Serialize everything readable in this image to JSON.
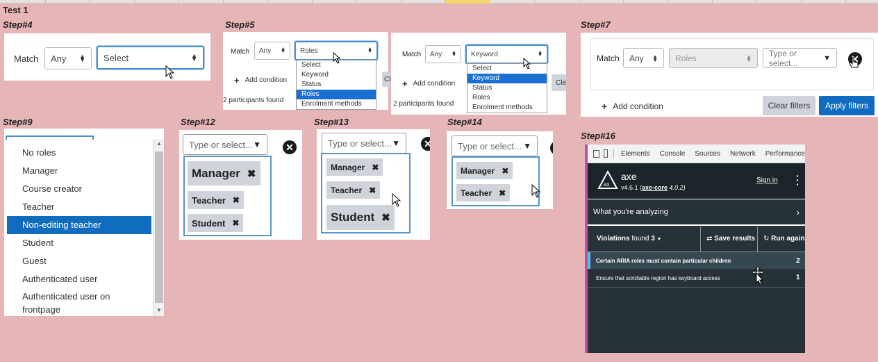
{
  "sheet_title": "Test 1",
  "common": {
    "match_label": "Match",
    "any_value": "Any",
    "add_condition": "Add condition",
    "participants_found": "2 participants found",
    "clear_filters": "Clear filters",
    "apply_filters": "Apply filters",
    "type_or_select": "Type or select...",
    "clear_partial": "Cl",
    "clear_partial_2": "Cle"
  },
  "step4": {
    "label": "Step#4",
    "select_value": "Select"
  },
  "step5": {
    "label": "Step#5",
    "panel_a": {
      "select_value": "Roles",
      "options": [
        "Select",
        "Keyword",
        "Status",
        "Roles",
        "Enrolment methods"
      ],
      "active_index": 3
    },
    "panel_b": {
      "select_value": "Keyword",
      "options": [
        "Select",
        "Keyword",
        "Status",
        "Roles",
        "Enrolment methods"
      ],
      "active_index": 1
    }
  },
  "step7": {
    "label": "Step#7",
    "roles_value": "Roles"
  },
  "step9": {
    "label": "Step#9",
    "items": [
      "No roles",
      "Manager",
      "Course creator",
      "Teacher",
      "Non-editing teacher",
      "Student",
      "Guest",
      "Authenticated user",
      "Authenticated user on frontpage"
    ],
    "active_index": 4
  },
  "step12": {
    "label": "Step#12",
    "tags": [
      "Manager",
      "Teacher",
      "Student"
    ]
  },
  "step13": {
    "label": "Step#13",
    "tags": [
      "Manager",
      "Teacher",
      "Student"
    ]
  },
  "step14": {
    "label": "Step#14",
    "tags": [
      "Manager",
      "Teacher"
    ]
  },
  "step16": {
    "label": "Step#16",
    "devtools_tabs": [
      "Elements",
      "Console",
      "Sources",
      "Network",
      "Performance"
    ],
    "axe_name": "axe",
    "axe_version": "v4.6.1 (",
    "axe_core_link": "axe-core",
    "axe_core_version": " 4.0.2)",
    "sign_in": "Sign in",
    "analyzing": "What you're analyzing",
    "violations_label": "Violations",
    "found_label": "found",
    "violations_count": "3",
    "save_results": "Save results",
    "run_again": "Run again",
    "issues": [
      {
        "text": "Certain ARIA roles must contain particular children",
        "count": "2"
      },
      {
        "text": "Ensure that scrollable region has keyboard access",
        "count": "1"
      }
    ]
  },
  "colors": {
    "background": "#e5b5b8",
    "focus_border": "#4a8fd0",
    "active_item": "#0f6cbf",
    "devtools_bg": "#263238",
    "axe_highlight": "#1e88e5"
  },
  "icons": [
    "up-down-arrows-icon",
    "caret-down-icon",
    "close-circle-icon",
    "remove-x-icon",
    "plus-icon",
    "mouse-pointer-icon",
    "hand-pointer-icon",
    "chevron-right-icon",
    "kebab-menu-icon",
    "save-icon",
    "refresh-icon",
    "inspect-icon",
    "device-toolbar-icon",
    "axe-logo-icon"
  ]
}
